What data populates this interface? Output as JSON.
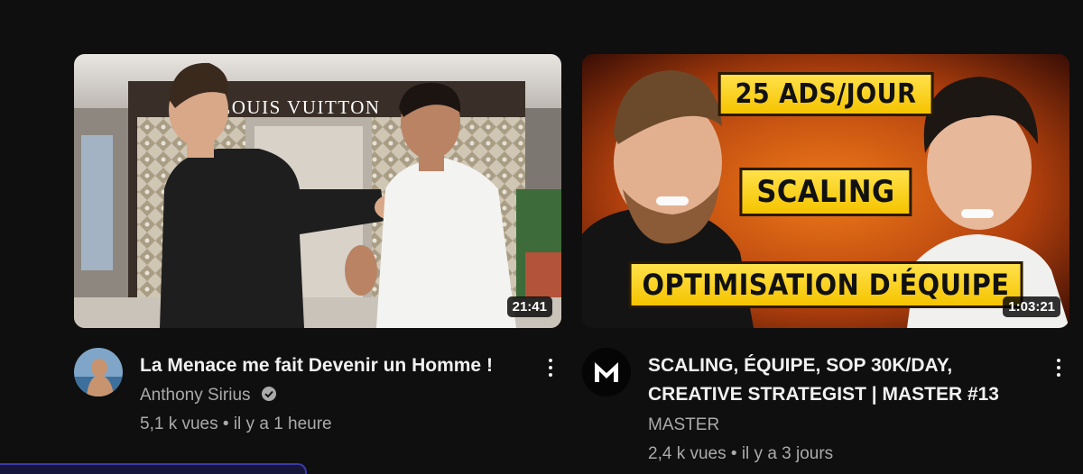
{
  "videos": [
    {
      "thumbnail_sign": "LOUIS VUITTON",
      "duration": "21:41",
      "title": "La Menace me fait Devenir un Homme !",
      "channel": "Anthony Sirius",
      "verified": true,
      "stats": "5,1 k vues • il y a 1 heure"
    },
    {
      "thumbnail_banners": [
        "25 ADS/JOUR",
        "SCALING",
        "OPTIMISATION D'ÉQUIPE"
      ],
      "duration": "1:03:21",
      "title": "SCALING, ÉQUIPE, SOP 30K/DAY, CREATIVE STRATEGIST | MASTER #13",
      "channel": "MASTER",
      "channel_logo": "M",
      "verified": false,
      "stats": "2,4 k vues • il y a 3 jours"
    }
  ],
  "colors": {
    "background": "#0f0f0f",
    "text_primary": "#f1f1f1",
    "text_secondary": "#aaaaaa",
    "banner_yellow": "#f5c400"
  },
  "icons": [
    "verified-badge-icon",
    "more-vert-icon"
  ]
}
